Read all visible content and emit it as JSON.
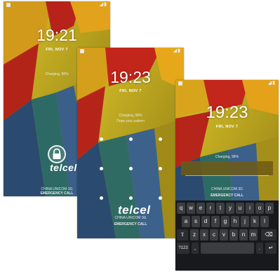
{
  "phones": {
    "screen1": {
      "time": "19:21",
      "date": "FRI, NOV 7",
      "charging": "Charging, 98%",
      "logo": "telcel",
      "carrier": "CHINA UNICOM 3G",
      "emergency": "EMERGENCY CALL",
      "unlock_icon": "padlock-icon"
    },
    "screen2": {
      "time": "19:23",
      "date": "FRI, NOV 7",
      "charging": "Charging, 98%",
      "prompt": "Draw your pattern",
      "logo": "telcel",
      "carrier": "CHINA UNICOM 3G",
      "emergency": "EMERGENCY CALL"
    },
    "screen3": {
      "time": "19:23",
      "date": "FRI, NOV 7",
      "charging": "Charging, 98%",
      "carrier": "CHINA UNICOM 3G",
      "emergency": "EMERGENCY CALL",
      "keyboard": {
        "row1": [
          "q",
          "w",
          "e",
          "r",
          "t",
          "y",
          "u",
          "i",
          "o",
          "p"
        ],
        "row2": [
          "a",
          "s",
          "d",
          "f",
          "g",
          "h",
          "j",
          "k",
          "l"
        ],
        "row3": [
          "z",
          "x",
          "c",
          "v",
          "b",
          "n",
          "m"
        ],
        "sym": "?123",
        "comma": ",",
        "period": "."
      }
    }
  },
  "colors": {
    "wall_red": "#c8261a",
    "wall_orange": "#e8a317",
    "wall_yellow": "#c9b21e",
    "wall_blue": "#2c4a70",
    "wall_teal": "#2d6a66",
    "keyboard_bg": "#17191c"
  }
}
